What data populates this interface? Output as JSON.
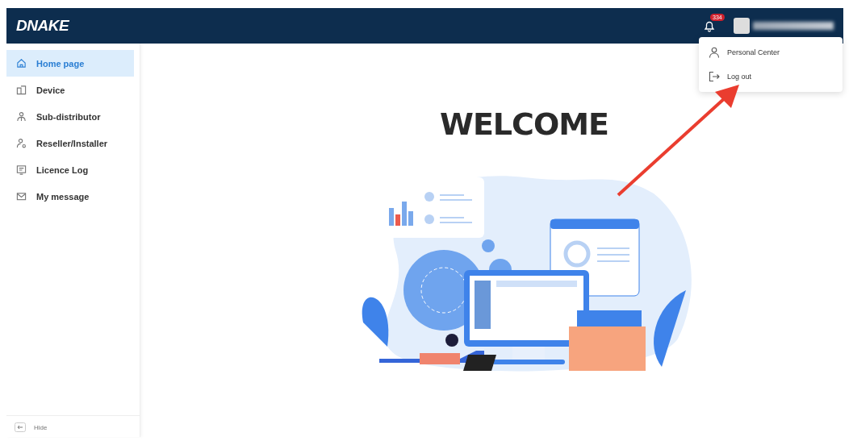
{
  "header": {
    "logo": "DNAKE",
    "notifications": {
      "count": "334"
    }
  },
  "sidebar": {
    "items": [
      {
        "label": "Home page",
        "selected": true
      },
      {
        "label": "Device",
        "selected": false
      },
      {
        "label": "Sub-distributor",
        "selected": false
      },
      {
        "label": "Reseller/Installer",
        "selected": false
      },
      {
        "label": "Licence Log",
        "selected": false
      },
      {
        "label": "My message",
        "selected": false
      }
    ],
    "hide_label": "Hide"
  },
  "user_menu": {
    "items": [
      {
        "label": "Personal Center"
      },
      {
        "label": "Log out"
      }
    ]
  },
  "main": {
    "heading": "WELCOME"
  }
}
